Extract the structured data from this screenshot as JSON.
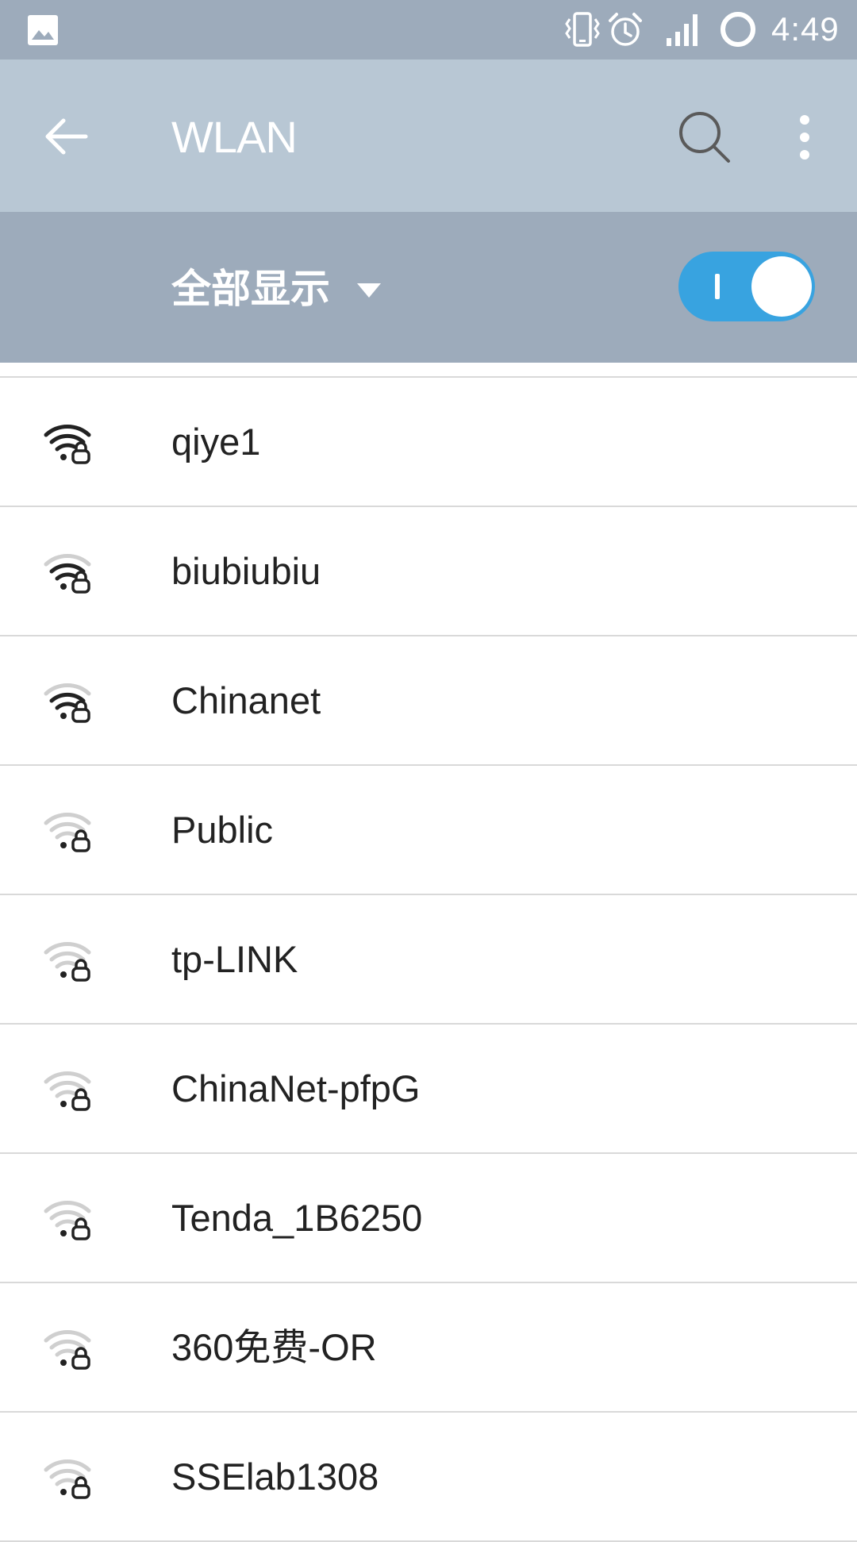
{
  "status_bar": {
    "time": "4:49",
    "icons": [
      "gallery-icon",
      "vibrate-icon",
      "alarm-icon",
      "signal-icon",
      "battery-icon"
    ]
  },
  "app_bar": {
    "title": "WLAN",
    "icons": [
      "back-arrow-icon",
      "search-icon",
      "more-vert-icon"
    ]
  },
  "filter": {
    "label": "全部显示",
    "wlan_enabled": true
  },
  "colors": {
    "status_bar": "#9dabbb",
    "app_bar": "#b8c7d4",
    "filter_bar": "#9dabbb",
    "toggle_on": "#38a3e0"
  },
  "networks": [
    {
      "name": "qiye1",
      "signal": 4,
      "secured": true
    },
    {
      "name": "biubiubiu",
      "signal": 3,
      "secured": true
    },
    {
      "name": "Chinanet",
      "signal": 3,
      "secured": true
    },
    {
      "name": "Public",
      "signal": 1,
      "secured": true
    },
    {
      "name": "tp-LINK",
      "signal": 1,
      "secured": true
    },
    {
      "name": "ChinaNet-pfpG",
      "signal": 1,
      "secured": true
    },
    {
      "name": "Tenda_1B6250",
      "signal": 1,
      "secured": true
    },
    {
      "name": "360免费-OR",
      "signal": 1,
      "secured": true
    },
    {
      "name": "SSElab1308",
      "signal": 1,
      "secured": true
    }
  ]
}
